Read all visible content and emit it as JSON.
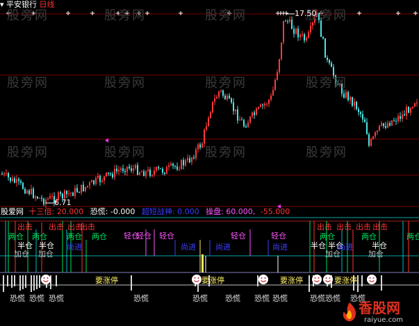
{
  "header": {
    "stock_name": "平安银行",
    "period": "日线"
  },
  "price_marks": {
    "high": "17.50",
    "low": "6.71"
  },
  "indicator_bar": {
    "name": "股爱网",
    "items": [
      {
        "label": "十三倍: 20.000",
        "color": "#ff3333"
      },
      {
        "label": "恐慌: -0.000",
        "color": "#ffffff"
      },
      {
        "label": "超短战神: 0.000",
        "color": "#3b3bff"
      },
      {
        "label": "操盘: 60.000,",
        "color": "#ff55ff"
      },
      {
        "label": "-55.000",
        "color": "#ff3333"
      }
    ]
  },
  "signals": {
    "chuji": "出击",
    "liangcang": "两仓",
    "qingcang": "轻仓",
    "banchang": "半仓",
    "jiacang": "加仓",
    "shangjin": "尚进",
    "zhangting": "要涨停",
    "konghuang": "恐慌"
  },
  "watermark": "股旁网",
  "logo": {
    "cn": "香股网",
    "url": "raiyue.com"
  },
  "colors": {
    "up": "#ff3b3b",
    "down": "#4ee6e6",
    "grid": "#800000",
    "accent_cyan": "#00d0d0"
  }
}
